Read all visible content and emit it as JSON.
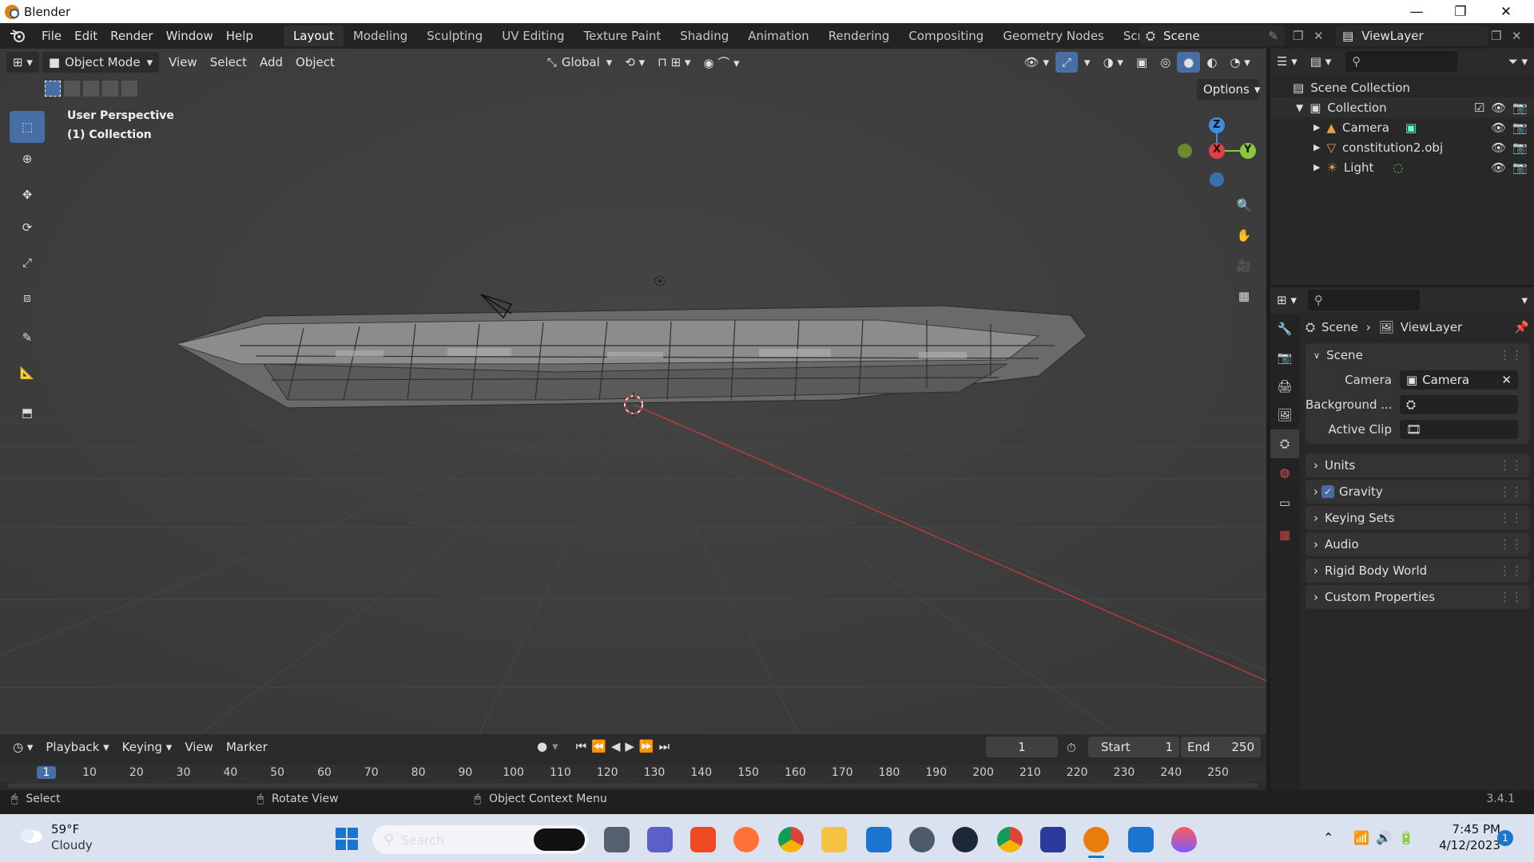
{
  "window": {
    "title": "Blender",
    "minimize": "—",
    "maximize": "❐",
    "close": "✕"
  },
  "menus": [
    "File",
    "Edit",
    "Render",
    "Window",
    "Help"
  ],
  "workspaces": [
    "Layout",
    "Modeling",
    "Sculpting",
    "UV Editing",
    "Texture Paint",
    "Shading",
    "Animation",
    "Rendering",
    "Compositing",
    "Geometry Nodes",
    "Scripting"
  ],
  "active_workspace": "Layout",
  "scene_field": "Scene",
  "viewlayer_field": "ViewLayer",
  "viewport": {
    "mode": "Object Mode",
    "menus": [
      "View",
      "Select",
      "Add",
      "Object"
    ],
    "transform": "Global",
    "options": "Options",
    "overlay_line1": "User Perspective",
    "overlay_line2": "(1) Collection",
    "gizmo": {
      "x": "X",
      "y": "Y",
      "z": "Z"
    }
  },
  "outliner": {
    "root": "Scene Collection",
    "collection": "Collection",
    "items": [
      "Camera",
      "constitution2.obj",
      "Light"
    ]
  },
  "properties": {
    "breadcrumb_scene": "Scene",
    "breadcrumb_viewlayer": "ViewLayer",
    "section": "Scene",
    "camera_label": "Camera",
    "camera_value": "Camera",
    "background_label": "Background ...",
    "active_clip_label": "Active Clip",
    "panels": [
      "Units",
      "Gravity",
      "Keying Sets",
      "Audio",
      "Rigid Body World",
      "Custom Properties"
    ],
    "gravity_checked": true
  },
  "timeline": {
    "menus": [
      "Playback",
      "Keying",
      "View",
      "Marker"
    ],
    "current_frame": "1",
    "start_label": "Start",
    "start_value": "1",
    "end_label": "End",
    "end_value": "250",
    "ruler": [
      "1",
      "10",
      "20",
      "30",
      "40",
      "50",
      "60",
      "70",
      "80",
      "90",
      "100",
      "110",
      "120",
      "130",
      "140",
      "150",
      "160",
      "170",
      "180",
      "190",
      "200",
      "210",
      "220",
      "230",
      "240",
      "250"
    ]
  },
  "status": {
    "select": "Select",
    "rotate": "Rotate View",
    "context": "Object Context Menu",
    "version": "3.4.1"
  },
  "taskbar": {
    "weather_temp": "59°F",
    "weather_desc": "Cloudy",
    "search": "Search",
    "time": "7:45 PM",
    "date": "4/12/2023",
    "notification_count": "1"
  },
  "colors": {
    "accent": "#476fa6",
    "x_axis": "#e0404a",
    "y_axis": "#8bc63f",
    "z_axis": "#3d8de0",
    "brand": "#e87d0d"
  }
}
